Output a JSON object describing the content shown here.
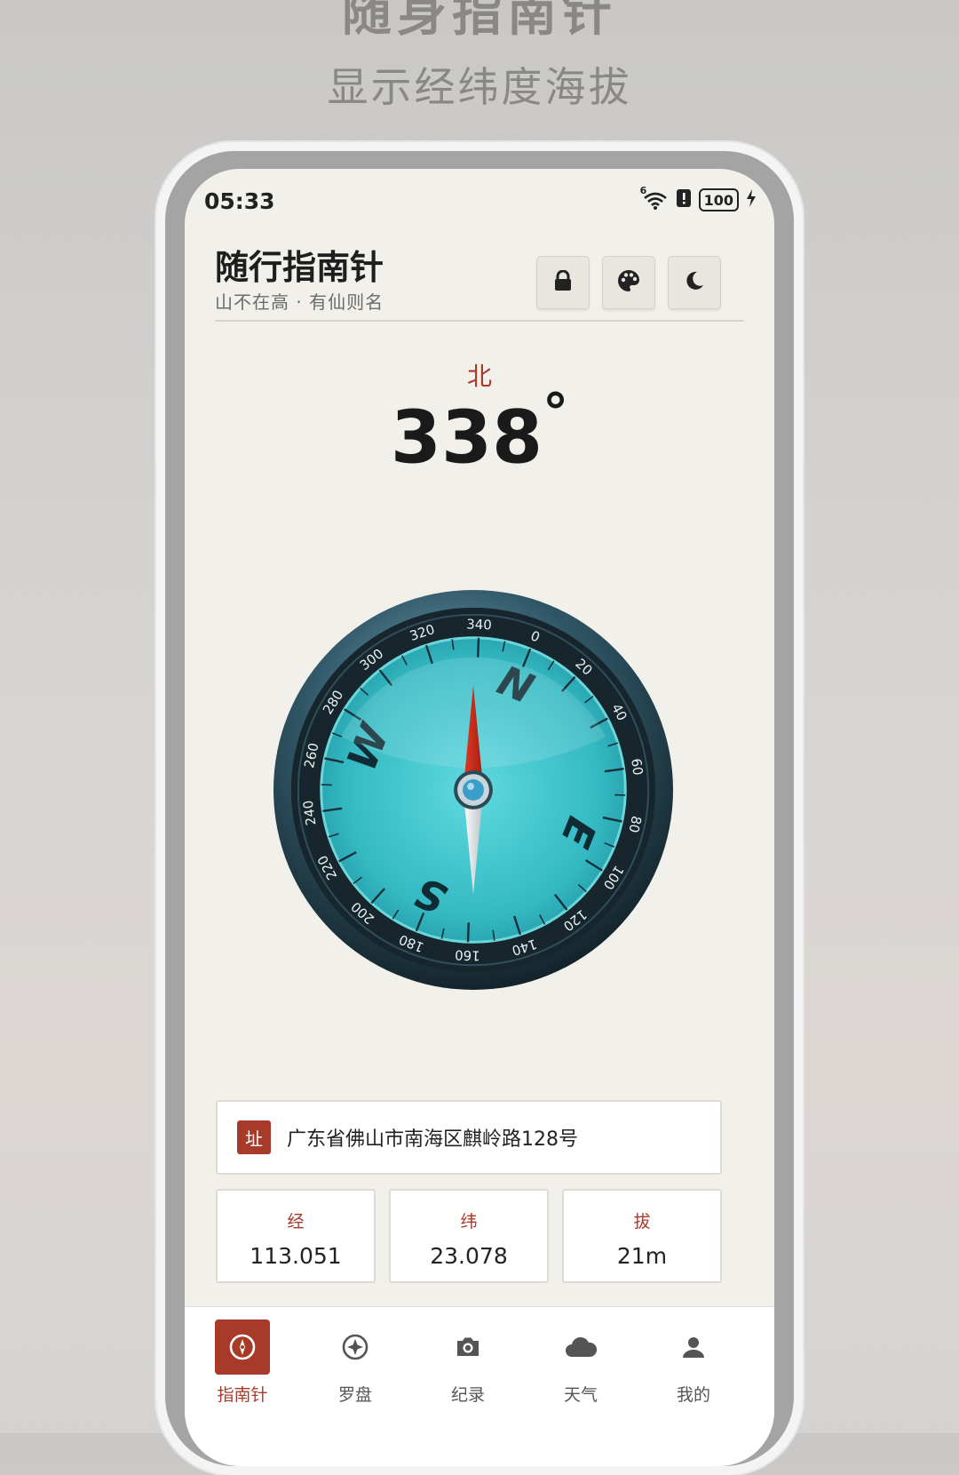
{
  "promo": {
    "title": "随身指南针",
    "subtitle": "显示经纬度海拔"
  },
  "status_bar": {
    "time": "05:33",
    "network": "6",
    "battery": "100",
    "icons": [
      "wifi-icon",
      "alert-icon",
      "battery-icon",
      "charging-icon"
    ]
  },
  "header": {
    "title": "随行指南针",
    "subtitle": "山不在高 · 有仙则名",
    "buttons": [
      "lock-icon",
      "palette-icon",
      "moon-icon"
    ]
  },
  "heading": {
    "direction": "北",
    "degrees": "338",
    "unit": "°"
  },
  "compass": {
    "cardinals": [
      "N",
      "E",
      "S",
      "W"
    ],
    "ticks": [
      "0",
      "20",
      "40",
      "60",
      "80",
      "100",
      "120",
      "140",
      "160",
      "180",
      "200",
      "220",
      "240",
      "260",
      "280",
      "300",
      "320",
      "340"
    ],
    "heading_deg": 338
  },
  "location": {
    "tag": "址",
    "address": "广东省佛山市南海区麒岭路128号"
  },
  "stats": [
    {
      "label": "经",
      "value": "113.051"
    },
    {
      "label": "纬",
      "value": "23.078"
    },
    {
      "label": "拔",
      "value": "21m"
    }
  ],
  "nav": [
    {
      "label": "指南针",
      "icon": "compass-icon",
      "active": true
    },
    {
      "label": "罗盘",
      "icon": "luopan-icon",
      "active": false
    },
    {
      "label": "纪录",
      "icon": "camera-icon",
      "active": false
    },
    {
      "label": "天气",
      "icon": "cloud-icon",
      "active": false
    },
    {
      "label": "我的",
      "icon": "user-icon",
      "active": false
    }
  ],
  "colors": {
    "accent": "#a83a2a",
    "dial": "#3fc6cf",
    "screen_bg": "#f2f0ea"
  }
}
